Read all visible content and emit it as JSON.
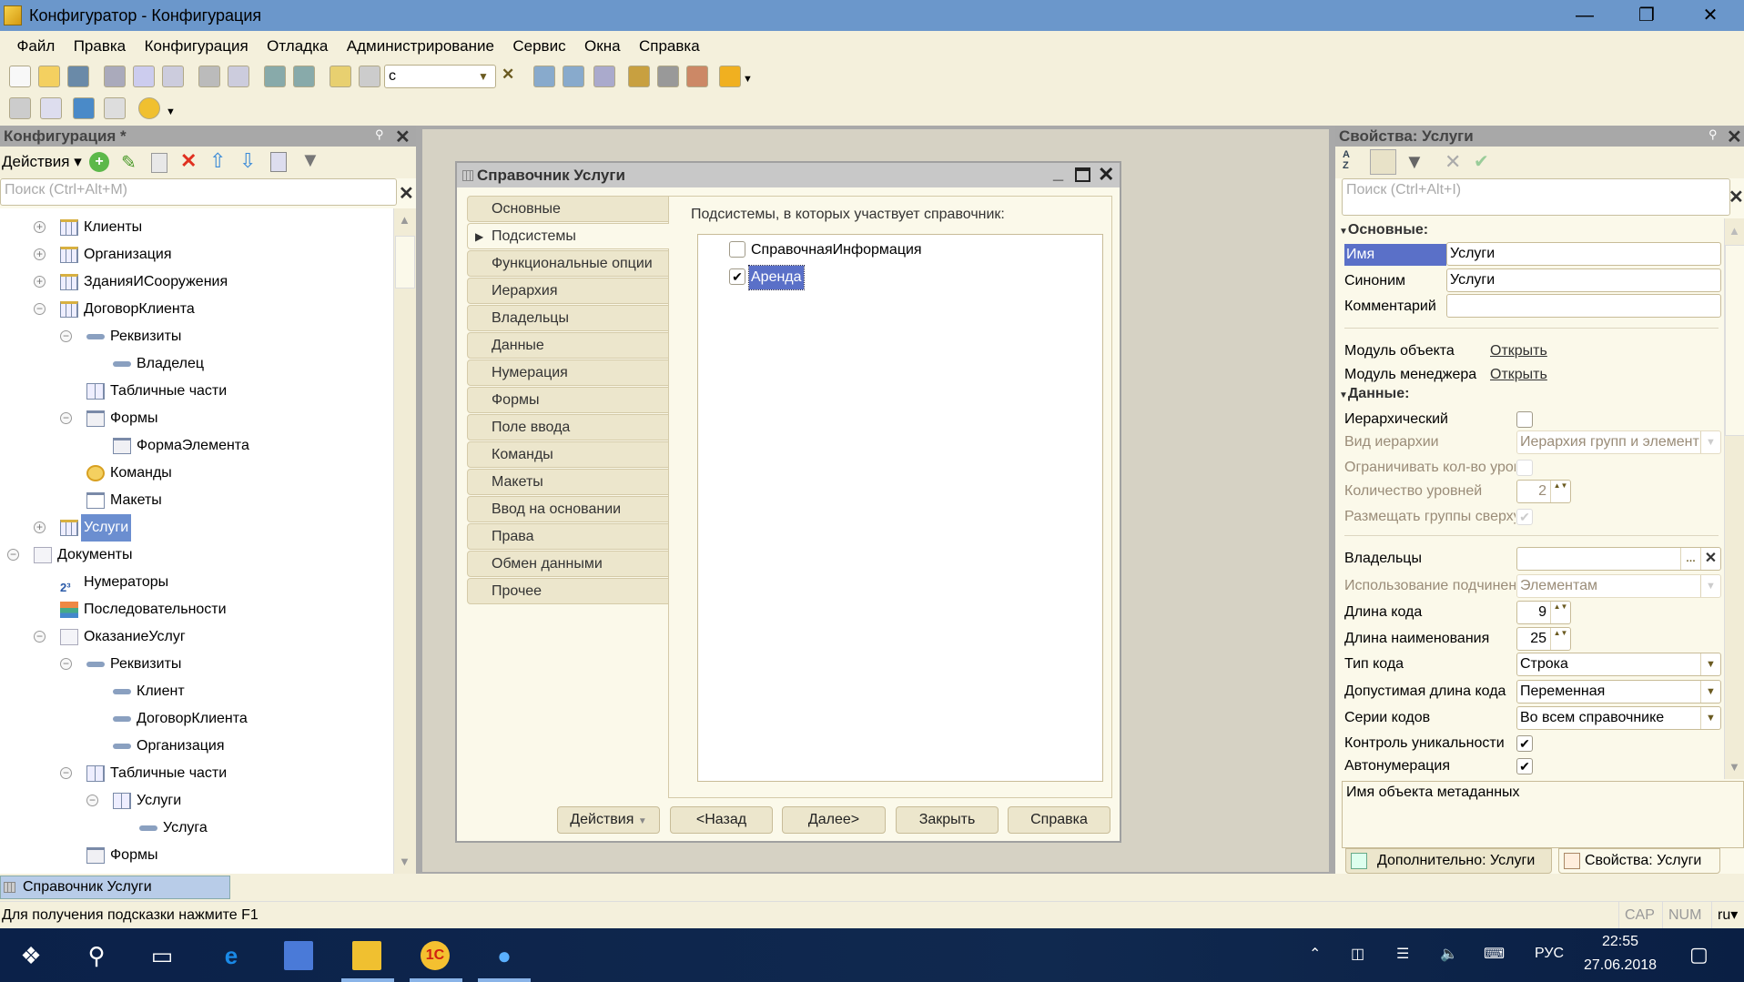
{
  "window": {
    "title": "Конфигуратор - Конфигурация"
  },
  "menu": [
    "Файл",
    "Правка",
    "Конфигурация",
    "Отладка",
    "Администрирование",
    "Сервис",
    "Окна",
    "Справка"
  ],
  "toolbar": {
    "search_value": "с"
  },
  "config_panel": {
    "title": "Конфигурация *",
    "actions_label": "Действия",
    "search_placeholder": "Поиск (Ctrl+Alt+M)",
    "tree": [
      {
        "label": "Клиенты",
        "level": 1,
        "exp": "plus",
        "icon": "catalog"
      },
      {
        "label": "Организация",
        "level": 1,
        "exp": "plus",
        "icon": "catalog"
      },
      {
        "label": "ЗданияИСооружения",
        "level": 1,
        "exp": "plus",
        "icon": "catalog"
      },
      {
        "label": "ДоговорКлиента",
        "level": 1,
        "exp": "minus",
        "icon": "catalog"
      },
      {
        "label": "Реквизиты",
        "level": 2,
        "exp": "minus",
        "icon": "attribute"
      },
      {
        "label": "Владелец",
        "level": 3,
        "exp": "",
        "icon": "attribute"
      },
      {
        "label": "Табличные части",
        "level": 2,
        "exp": "",
        "icon": "tabular"
      },
      {
        "label": "Формы",
        "level": 2,
        "exp": "minus",
        "icon": "form"
      },
      {
        "label": "ФормаЭлемента",
        "level": 3,
        "exp": "",
        "icon": "form"
      },
      {
        "label": "Команды",
        "level": 2,
        "exp": "",
        "icon": "command"
      },
      {
        "label": "Макеты",
        "level": 2,
        "exp": "",
        "icon": "template"
      },
      {
        "label": "Услуги",
        "level": 1,
        "exp": "plus",
        "icon": "catalog",
        "selected": true
      },
      {
        "label": "Документы",
        "level": 0,
        "exp": "minus",
        "icon": "document"
      },
      {
        "label": "Нумераторы",
        "level": 1,
        "exp": "",
        "icon": "numerator"
      },
      {
        "label": "Последовательности",
        "level": 1,
        "exp": "",
        "icon": "sequence"
      },
      {
        "label": "ОказаниеУслуг",
        "level": 1,
        "exp": "minus",
        "icon": "document"
      },
      {
        "label": "Реквизиты",
        "level": 2,
        "exp": "minus",
        "icon": "attribute"
      },
      {
        "label": "Клиент",
        "level": 3,
        "exp": "",
        "icon": "attribute"
      },
      {
        "label": "ДоговорКлиента",
        "level": 3,
        "exp": "",
        "icon": "attribute"
      },
      {
        "label": "Организация",
        "level": 3,
        "exp": "",
        "icon": "attribute"
      },
      {
        "label": "Табличные части",
        "level": 2,
        "exp": "minus",
        "icon": "tabular"
      },
      {
        "label": "Услуги",
        "level": 3,
        "exp": "minus",
        "icon": "tabular"
      },
      {
        "label": "Услуга",
        "level": 4,
        "exp": "",
        "icon": "attribute"
      },
      {
        "label": "Формы",
        "level": 2,
        "exp": "",
        "icon": "form"
      }
    ]
  },
  "dialog": {
    "title": "Справочник Услуги",
    "tabs": [
      "Основные",
      "Подсистемы",
      "Функциональные опции",
      "Иерархия",
      "Владельцы",
      "Данные",
      "Нумерация",
      "Формы",
      "Поле ввода",
      "Команды",
      "Макеты",
      "Ввод на основании",
      "Права",
      "Обмен данными",
      "Прочее"
    ],
    "active_tab": "Подсистемы",
    "content_label": "Подсистемы, в которых участвует справочник:",
    "subsystems": [
      {
        "label": "СправочнаяИнформация",
        "checked": false
      },
      {
        "label": "Аренда",
        "checked": true,
        "selected": true
      }
    ],
    "buttons": {
      "actions": "Действия",
      "back": "<Назад",
      "next": "Далее>",
      "close": "Закрыть",
      "help": "Справка"
    }
  },
  "properties": {
    "title": "Свойства: Услуги",
    "search_placeholder": "Поиск (Ctrl+Alt+I)",
    "rows": [
      {
        "type": "section",
        "label": "Основные:"
      },
      {
        "type": "field",
        "label": "Имя",
        "value": "Услуги",
        "selected": true
      },
      {
        "type": "field",
        "label": "Синоним",
        "value": "Услуги"
      },
      {
        "type": "field",
        "label": "Комментарий",
        "value": ""
      },
      {
        "type": "sep"
      },
      {
        "type": "link",
        "label": "Модуль объекта",
        "value": "Открыть"
      },
      {
        "type": "link",
        "label": "Модуль менеджера",
        "value": "Открыть"
      },
      {
        "type": "section",
        "label": "Данные:"
      },
      {
        "type": "check",
        "label": "Иерархический",
        "checked": false
      },
      {
        "type": "select",
        "label": "Вид иерархии",
        "value": "Иерархия групп и элемент",
        "disabled": true
      },
      {
        "type": "check",
        "label": "Ограничивать кол-во уровней",
        "checked": false,
        "disabled": true
      },
      {
        "type": "spin",
        "label": "Количество уровней",
        "value": "2",
        "disabled": true
      },
      {
        "type": "check",
        "label": "Размещать группы сверху",
        "checked": true,
        "disabled": true
      },
      {
        "type": "sep"
      },
      {
        "type": "owner",
        "label": "Владельцы",
        "value": ""
      },
      {
        "type": "select",
        "label": "Использование подчинения",
        "value": "Элементам",
        "disabled": true
      },
      {
        "type": "spin",
        "label": "Длина кода",
        "value": "9"
      },
      {
        "type": "spin",
        "label": "Длина наименования",
        "value": "25"
      },
      {
        "type": "select",
        "label": "Тип кода",
        "value": "Строка"
      },
      {
        "type": "select",
        "label": "Допустимая длина кода",
        "value": "Переменная"
      },
      {
        "type": "select",
        "label": "Серии кодов",
        "value": "Во всем справочнике"
      },
      {
        "type": "check",
        "label": "Контроль уникальности",
        "checked": true
      },
      {
        "type": "check",
        "label": "Автонумерация",
        "checked": true
      }
    ],
    "description": "Имя объекта метаданных",
    "bottom_tabs": [
      "Дополнительно: Услуги",
      "Свойства: Услуги"
    ]
  },
  "window_tab": "Справочник Услуги",
  "status": {
    "hint": "Для получения подсказки нажмите F1",
    "cap": "CAP",
    "num": "NUM",
    "lang": "ru"
  },
  "taskbar": {
    "lang": "РУС",
    "time": "22:55",
    "date": "27.06.2018"
  },
  "colors": {
    "titlebar": "#6b97cb",
    "selection": "#6b8ed0",
    "panel_bg": "#fbf9ea",
    "taskbar": "#0b2149"
  }
}
